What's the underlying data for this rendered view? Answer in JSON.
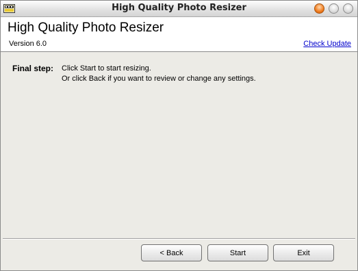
{
  "window": {
    "title": "High Quality Photo Resizer"
  },
  "header": {
    "app_title": "High Quality Photo Resizer",
    "version": "Version 6.0",
    "check_update": "Check Update"
  },
  "step": {
    "label": "Final step:",
    "lines": [
      "Click Start to start resizing.",
      "Or click Back if you want to review or change any settings."
    ]
  },
  "buttons": {
    "back": "< Back",
    "start": "Start",
    "exit": "Exit"
  },
  "icons": {
    "app": "photo-resizer-app-icon",
    "close": "close-icon",
    "minimize": "minimize-icon",
    "maximize": "maximize-icon"
  },
  "colors": {
    "link": "#0000cc",
    "close_button": "#f07c1e",
    "background": "#ecebe6"
  }
}
